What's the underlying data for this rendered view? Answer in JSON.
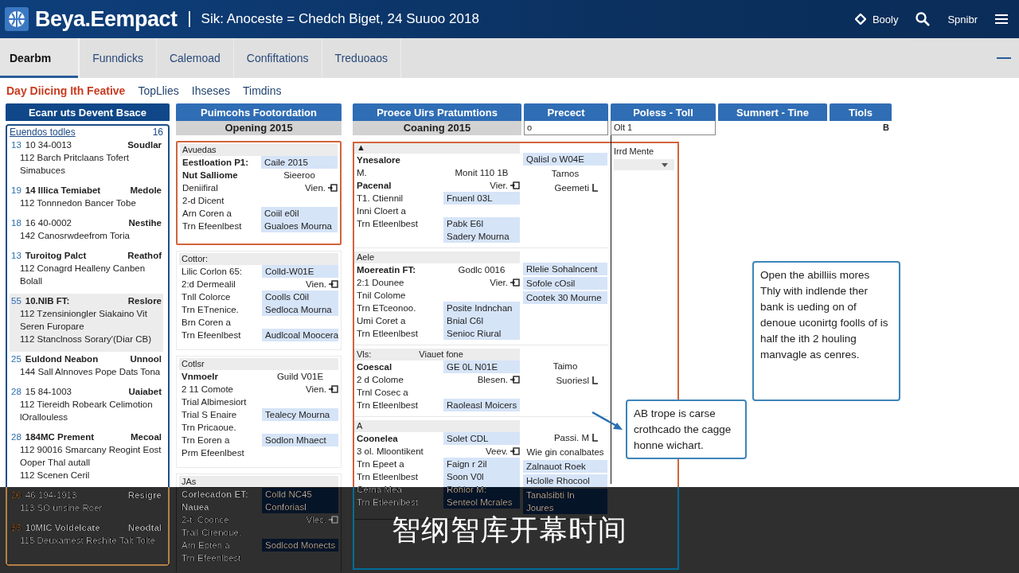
{
  "header": {
    "logo": "Beya.Eempact",
    "context": "Sik: Anoceste = Chedch Biget, 24 Suuoo 2018",
    "actions": [
      {
        "kind": "diamond",
        "label": "Booly"
      },
      {
        "kind": "search"
      },
      {
        "kind": "text",
        "label": "Spnibr"
      },
      {
        "kind": "menu"
      }
    ]
  },
  "tabs": [
    {
      "label": "Dearbm",
      "selected": true
    },
    {
      "label": "Funndicks",
      "selected": false
    },
    {
      "label": "Calemoad",
      "selected": false
    },
    {
      "label": "Confiftations",
      "selected": false
    },
    {
      "label": "Treduoaos",
      "selected": false
    }
  ],
  "subtabs": [
    {
      "label": "Day Diicing Ith Feative",
      "selected": true
    },
    {
      "label": "TopLlies",
      "selected": false
    },
    {
      "label": "Ihseses",
      "selected": false
    },
    {
      "label": "Timdins",
      "selected": false
    }
  ],
  "list_panel": {
    "title": "Ecanr uts Devent Bsace",
    "list_title": "Euendos todles",
    "count": "16",
    "entries": [
      {
        "number": "13",
        "title": "10 34-0013",
        "bold": false,
        "status": "Soudlar",
        "selected": false,
        "lines": [
          "112 Barch Pritclaans Tofert",
          "Simabuces"
        ]
      },
      {
        "number": "19",
        "title": "14 Illica Temiabet",
        "bold": true,
        "status": "Medole",
        "selected": false,
        "lines": [
          "112 Tonnnedon Bancer Tobe"
        ]
      },
      {
        "number": "18",
        "title": "16 40-0002",
        "bold": false,
        "status": "Nestihe",
        "selected": false,
        "lines": [
          "142 Canosrwdeefrom Toria"
        ]
      },
      {
        "number": "13",
        "title": "Turoitog Palct",
        "bold": true,
        "status": "Reathof",
        "selected": false,
        "lines": [
          "112 Conagrd Healleny Canben",
          "Bolall"
        ]
      },
      {
        "number": "55",
        "title": "10.NIB FT:",
        "bold": true,
        "status": "Reslore",
        "selected": true,
        "lines": [
          "112 Tzensiniongler Siakaino Vit",
          "Seren Furopare",
          "112 Stanclnoss Sorary'(Diar CB)"
        ]
      },
      {
        "number": "25",
        "title": "Euldond Neabon",
        "bold": true,
        "status": "Unnool",
        "selected": false,
        "lines": [
          "144 Sall Alnnoves Pope Dats Tona"
        ]
      },
      {
        "number": "28",
        "title": "15 84-1003",
        "bold": false,
        "status": "Uaiabet",
        "selected": false,
        "lines": [
          "112 Tiereidh Robeark Celimotion",
          "lOrallouless"
        ]
      },
      {
        "number": "28",
        "title": "184MC Prement",
        "bold": true,
        "status": "Mecoal",
        "selected": false,
        "lines": [
          "112 90016 Smarcany Reogint Eost",
          "Ooper Thal autall",
          "112 Scenen Ceril"
        ]
      },
      {
        "number": "20",
        "title": "46 194-1913",
        "bold": false,
        "status": "Resigre",
        "selected": false,
        "lines": [
          "113 SO unsine Roer"
        ]
      },
      {
        "number": "35",
        "title": "10MIC Voldelcate",
        "bold": true,
        "status": "Neodtal",
        "selected": false,
        "lines": [
          "115 Deuxamest Reshite Talt Tolte"
        ]
      }
    ]
  },
  "middle_panel": {
    "title": "Puimcohs Footordation",
    "subtitle": "Opening 2015",
    "cards": [
      {
        "header": "Avuedas",
        "selected": true,
        "rows": [
          {
            "label": "Eestloation P1:",
            "bold": true,
            "kind": "chip",
            "value": "Caile 2015"
          },
          {
            "label": "Nut Salliome",
            "bold": true,
            "kind": "text",
            "value": "Sieeroo"
          },
          {
            "label": "Deniifiral",
            "bold": false,
            "kind": "view",
            "value": "Vien."
          },
          {
            "label": "2-d Dicent",
            "bold": false,
            "kind": "none"
          },
          {
            "label": "Arn Coren a",
            "bold": false,
            "kind": "chip",
            "value": "Coiil e0il"
          },
          {
            "label": "Trn Efeenlbest",
            "bold": false,
            "kind": "chip",
            "value": "Gualoes Mourna"
          }
        ]
      },
      {
        "header": "Cottor:",
        "selected": false,
        "rows": [
          {
            "label": "Lilic Corlon 65:",
            "bold": false,
            "kind": "chip",
            "value": "Colld-W01E"
          },
          {
            "label": "2:d Dermealil",
            "bold": false,
            "kind": "view",
            "value": "Vien."
          },
          {
            "label": "Tnll Colorce",
            "bold": false,
            "kind": "chip",
            "value": "Coolls C0il"
          },
          {
            "label": "Trn ETnenice.",
            "bold": false,
            "kind": "chip",
            "value": "Sedloca Mourna"
          },
          {
            "label": "Brn Coren a",
            "bold": false,
            "kind": "none"
          },
          {
            "label": "Trn Efeenlbest",
            "bold": false,
            "kind": "chip",
            "value": "Audlcoal Moocera"
          }
        ]
      },
      {
        "header": "Cotlsr",
        "selected": false,
        "rows": [
          {
            "label": "Vnmoelr",
            "bold": true,
            "kind": "text",
            "value": "Guild V01E"
          },
          {
            "label": "2 11 Comote",
            "bold": false,
            "kind": "view",
            "value": "Vien."
          },
          {
            "label": "Trial Albimesiort",
            "bold": false,
            "kind": "none"
          },
          {
            "label": "Trial S Enaire",
            "bold": false,
            "kind": "chip",
            "value": "Tealecy Mourna"
          },
          {
            "label": "Trn Pricaoue.",
            "bold": false,
            "kind": "none"
          },
          {
            "label": "Trn Eoren a",
            "bold": false,
            "kind": "chip",
            "value": "Sodlon Mhaect"
          },
          {
            "label": "Prm Efeenlbest",
            "bold": false,
            "kind": "none"
          }
        ]
      },
      {
        "header": "JAs",
        "selected": false,
        "rows": [
          {
            "label": "Corlecadon ET:",
            "bold": true,
            "kind": "chip",
            "value": "Colld NC45"
          },
          {
            "label": "Nauea",
            "bold": true,
            "kind": "chip",
            "value": "Conforiasl"
          },
          {
            "label": "2-t. Coonce",
            "bold": false,
            "kind": "view",
            "value": "Vlec."
          },
          {
            "label": "Trall Cirenoue.",
            "bold": false,
            "kind": "none"
          },
          {
            "label": "Arn Epten a",
            "bold": false,
            "kind": "chip",
            "value": "Sodlcod Monects"
          },
          {
            "label": "Trn Efeenlbest",
            "bold": false,
            "kind": "none"
          }
        ]
      }
    ]
  },
  "right_table": {
    "columns": [
      "Proece Uirs Pratumtions",
      "Precect",
      "Poless - Toll",
      "Sumnert - Tine",
      "Tiols"
    ],
    "first_row": {
      "column_1": "Coaning 2015",
      "column_2": "o",
      "column_3": "Olt 1",
      "column_5": "B"
    },
    "cards": [
      {
        "header": "▲",
        "rows": [
          {
            "label": "Ynesalore",
            "bold": true,
            "kind": "none"
          },
          {
            "label": "M.",
            "bold": false,
            "kind": "text",
            "value": "Monit 110 1B"
          },
          {
            "label": "Pacenal",
            "bold": true,
            "kind": "view",
            "value": "Vier."
          },
          {
            "label": "T1. Ctiennil",
            "bold": false,
            "kind": "chip",
            "value": "Fnuenl 03L"
          },
          {
            "label": "Inni Cloert a",
            "bold": false,
            "kind": "none"
          },
          {
            "label": "Trn Etleenlbest",
            "bold": false,
            "kind": "chip",
            "value": "Pabk E6l"
          },
          {
            "kind": "chip",
            "value": "Sadery Mourna"
          }
        ],
        "side": [
          {
            "kind": "chip",
            "text": "Qalisl o W04E"
          },
          {
            "kind": "text",
            "text": "Tarnos"
          },
          {
            "kind": "icon",
            "text": "Geemeti"
          }
        ]
      },
      {
        "header": "Aele",
        "rows": [
          {
            "label": "Moereatin FT:",
            "bold": true,
            "kind": "text",
            "value": "Godlc 0016"
          },
          {
            "label": "2:1 Dounee",
            "bold": false,
            "kind": "view",
            "value": "Vier."
          },
          {
            "label": "Tnil Colome",
            "bold": false,
            "kind": "none"
          },
          {
            "label": "Trn ETceonoo.",
            "bold": false,
            "kind": "chip",
            "value": "Posite Indnchan"
          },
          {
            "label": "Umi Coret a",
            "bold": false,
            "kind": "chip",
            "value": "Bnial C6l"
          },
          {
            "label": "Trn Etleenlbest",
            "bold": false,
            "kind": "chip",
            "value": "Senioc Riural"
          }
        ],
        "side": [
          {
            "kind": "chip",
            "text": "Rlelie Sohalncent"
          },
          {
            "kind": "chip",
            "text": "Sofole cOsil"
          },
          {
            "kind": "chip",
            "text": "Cootek 30 Mourne"
          }
        ]
      },
      {
        "header": "Vls:",
        "note": "Viauet fone",
        "rows": [
          {
            "label": "Coescal",
            "bold": true,
            "kind": "chip",
            "value": "GE 0L N01E"
          },
          {
            "label": "2 d Colome",
            "bold": false,
            "kind": "view",
            "value": "Blesen."
          },
          {
            "label": "Trnl Cosec a",
            "bold": false,
            "kind": "none"
          },
          {
            "label": "Trn Etleenlbest",
            "bold": false,
            "kind": "chip",
            "value": "Raoleasl Moicers"
          }
        ],
        "side": [
          {
            "kind": "text",
            "text": "Taimo"
          },
          {
            "kind": "icon",
            "text": "Suoriesl"
          }
        ]
      },
      {
        "header": "A",
        "rows": [
          {
            "label": "Coonelea",
            "bold": true,
            "kind": "chip",
            "value": "Solet CDL"
          },
          {
            "label": "3 ol. Mloontikent",
            "bold": false,
            "kind": "view",
            "value": "Veev."
          },
          {
            "label": "Trn Epeet a",
            "bold": false,
            "kind": "chip",
            "value": "Faign r 2il"
          },
          {
            "label": "Trn Etleenlbest",
            "bold": false,
            "kind": "chip",
            "value": "Soon V0l"
          },
          {
            "label": "Cerna Mea",
            "bold": false,
            "kind": "chip",
            "value": "Rohlor M:"
          },
          {
            "label": "Trn Etleenlbest",
            "bold": false,
            "kind": "chip",
            "value": "Senteol Mcrales"
          }
        ],
        "side": [
          {
            "kind": "icon",
            "text": "Passi. M"
          },
          {
            "kind": "text",
            "text": "Wie gin conalbates"
          },
          {
            "kind": "chip",
            "text": "Zalnauot Roek"
          },
          {
            "kind": "chip",
            "text": "Hclolle Rhocool"
          },
          {
            "kind": "chip",
            "text": "Tanalsibti In Joures"
          }
        ]
      }
    ],
    "poless_items": [
      {
        "kind": "text",
        "text": "Irrd Mente"
      },
      {
        "kind": "dropdown"
      }
    ]
  },
  "callouts": [
    {
      "text": "Open the abilliis mores Thly with indlende ther bank is ueding on of denoue uconirtg foolls of is half the ith 2 houling manvagle as cenres.",
      "kind": "plain"
    },
    {
      "text": "AB trope is carse crothcado the cagge honne wichart.",
      "kind": "pointer"
    }
  ],
  "caption": "智纲智库开幕时间"
}
